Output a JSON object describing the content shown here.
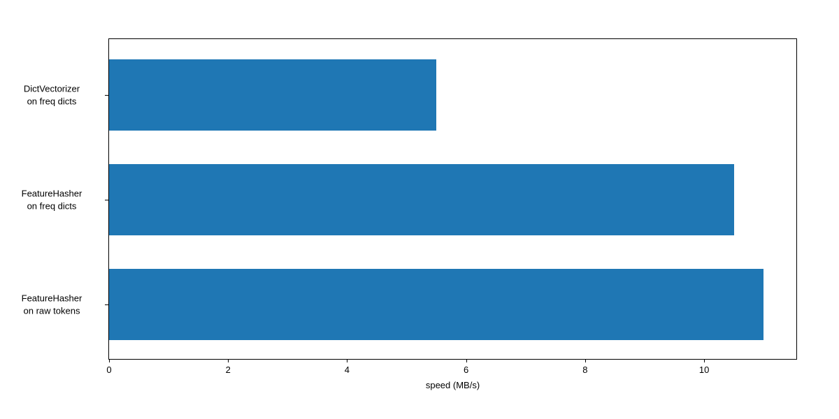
{
  "chart_data": {
    "type": "bar",
    "orientation": "horizontal",
    "categories": [
      "FeatureHasher\non raw tokens",
      "FeatureHasher\non freq dicts",
      "DictVectorizer\non freq dicts"
    ],
    "values": [
      11.0,
      10.5,
      5.5
    ],
    "xlabel": "speed (MB/s)",
    "ylabel": "",
    "title": "",
    "xlim": [
      0,
      11.55
    ],
    "x_ticks": [
      0,
      2,
      4,
      6,
      8,
      10
    ],
    "bar_color": "#1f77b4"
  }
}
